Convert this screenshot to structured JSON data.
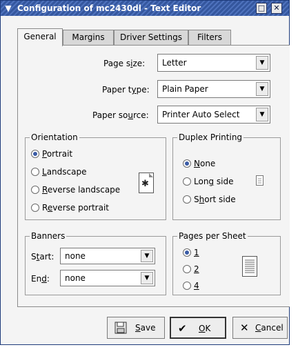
{
  "window": {
    "title": "Configuration of mc2430dl - Text Editor"
  },
  "tabs": [
    {
      "label": "General",
      "active": true
    },
    {
      "label": "Margins",
      "active": false
    },
    {
      "label": "Driver Settings",
      "active": false
    },
    {
      "label": "Filters",
      "active": false
    }
  ],
  "general": {
    "page_size": {
      "label_pre": "Page s",
      "label_u": "i",
      "label_post": "ze:",
      "value": "Letter"
    },
    "paper_type": {
      "label_pre": "Paper t",
      "label_u": "y",
      "label_post": "pe:",
      "value": "Plain Paper"
    },
    "paper_source": {
      "label_pre": "Paper so",
      "label_u": "u",
      "label_post": "rce:",
      "value": "Printer Auto Select"
    }
  },
  "orientation": {
    "title": "Orientation",
    "options": [
      {
        "u": "P",
        "rest": "ortrait",
        "selected": true
      },
      {
        "u": "L",
        "rest": "andscape",
        "selected": false
      },
      {
        "u": "R",
        "rest": "everse landscape",
        "selected": false
      },
      {
        "pre": "R",
        "u": "e",
        "rest": "verse portrait",
        "selected": false
      }
    ]
  },
  "duplex": {
    "title": "Duplex Printing",
    "options": [
      {
        "u": "N",
        "rest": "one",
        "selected": true
      },
      {
        "pre": "Lon",
        "u": "g",
        "rest": " side",
        "selected": false
      },
      {
        "pre": "S",
        "u": "h",
        "rest": "ort side",
        "selected": false
      }
    ]
  },
  "banners": {
    "title": "Banners",
    "start": {
      "pre": "S",
      "u": "t",
      "rest": "art:",
      "value": "none"
    },
    "end": {
      "pre": "En",
      "u": "d",
      "rest": ":",
      "value": "none"
    }
  },
  "pages_per_sheet": {
    "title": "Pages per Sheet",
    "options": [
      {
        "u": "1",
        "selected": true
      },
      {
        "u": "2",
        "selected": false
      },
      {
        "u": "4",
        "selected": false
      }
    ]
  },
  "buttons": {
    "save": {
      "u": "S",
      "rest": "ave"
    },
    "ok": {
      "u": "O",
      "rest": "K"
    },
    "cancel": {
      "u": "C",
      "rest": "ancel"
    }
  },
  "icons": {
    "title_menu": "chevron-down-icon",
    "minimize": "minimize-icon",
    "close": "close-icon",
    "orientation_preview": "page-rotate-icon",
    "duplex_preview": "single-page-icon",
    "pages_preview": "page-lines-icon",
    "save": "floppy-disk-icon",
    "ok": "checkmark-icon",
    "cancel": "x-cancel-icon"
  },
  "colors": {
    "titlebar": "#35579e",
    "radio_fill": "#3b5ca6",
    "background": "#f4f4f4"
  }
}
